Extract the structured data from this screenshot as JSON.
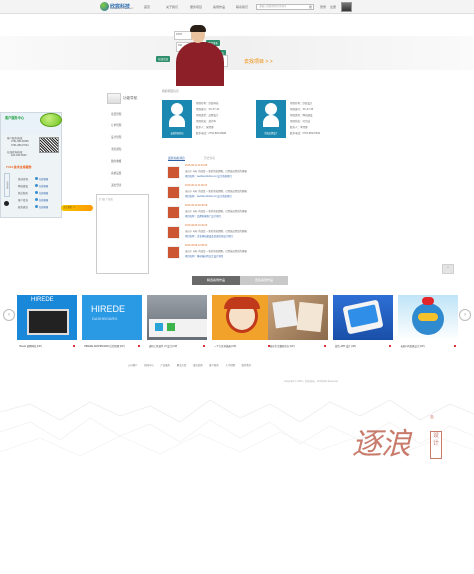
{
  "header": {
    "logo_text": "欣宸科技",
    "logo_sub": "XINCHEN TECHNOLOGY",
    "nav": [
      "首页",
      "关于我们",
      "服务项目",
      "案例作品",
      "联系我们"
    ],
    "search_placeholder": "请输入您要搜索的关键字",
    "search_button": "搜",
    "links": [
      "登录",
      "注册"
    ]
  },
  "hero": {
    "cta": "去找项目 > >",
    "labels": [
      "在线洽谈",
      "项目发布",
      "需求提交"
    ],
    "card_lines": [
      "欢迎您",
      "创意",
      "设计"
    ]
  },
  "left_panel": {
    "title": "客户服务中心",
    "lines": [
      "客户服务热线：",
      "0791-88134698",
      "0791-88107634",
      "在线咨询热线：",
      "400-030-8020"
    ],
    "hotline": "7×24 技术支持服务",
    "rows": [
      {
        "k": "售前咨询",
        "v": "在线客服"
      },
      {
        "k": "网站建设",
        "v": "在线客服"
      },
      {
        "k": "售后服务",
        "v": "在线客服"
      },
      {
        "k": "客户投诉",
        "v": "在线客服"
      },
      {
        "k": "服务建议",
        "v": "在线客服"
      }
    ],
    "vertical_label": "在线客服",
    "button": "关注我们 >>"
  },
  "sidenav": {
    "title": "功能导航",
    "items": [
      "项目管理",
      "订单管理",
      "设计管理",
      "消息通知",
      "我的收藏",
      "系统设置",
      "退出登录"
    ]
  },
  "ad": {
    "title": "[广告] 广告位"
  },
  "info": {
    "title": "我的项目信息",
    "profiles": [
      {
        "label": "安徽欣宸科技",
        "lines": [
          "项目名称：欣宸科技",
          "项目编号：XC-07-34",
          "项目类型：品牌设计",
          "项目状态：进行中",
          "联系人：张经理",
          "联系电话：0791-88134698",
          "联系邮箱：info@xinchen"
        ]
      },
      {
        "label": "欣宸品牌设计",
        "lines": [
          "项目名称：欣宸设计",
          "项目编号：XC-07-35",
          "项目类型：网站建设",
          "项目状态：已完成",
          "联系人：李经理",
          "联系电话：0791-88107634",
          "联系邮箱：web@xinchen"
        ]
      }
    ]
  },
  "tabs": {
    "active": "最新动态消息",
    "inactive": "历史消息"
  },
  "feed": [
    {
      "date": "2015-08-11 14:20:08",
      "l1": "来自于 ugly. 的回复 -- 新的消息提醒，已经发送到您的邮箱",
      "l2": "项目名称：wechat.xinchen.cn 设计系统项目"
    },
    {
      "date": "2015-08-11 14:08:16",
      "l1": "来自于 ugly. 的回复 -- 新的消息提醒，已经发送到您的邮箱",
      "l2": "项目名称：wechat.xinchen.cn 设计系统项目"
    },
    {
      "date": "2015-08-10 09:46:08",
      "l1": "来自于 ugly. 的回复 -- 新的消息提醒，已经发送到您的邮箱",
      "l2": "项目名称：品牌形象推广设计项目"
    },
    {
      "date": "2015-08-09 16:40:20",
      "l1": "来自于 ugly. 的回复 -- 新的消息提醒，已经发送到您的邮箱",
      "l2": "项目名称：企业网站建设及页面优化设计项目"
    },
    {
      "date": "2015-08-08 12:08:02",
      "l1": "来自于 ugly. 的回复 -- 新的消息提醒，已经发送到您的邮箱",
      "l2": "项目名称：移动端应用交互设计项目"
    }
  ],
  "works": {
    "tab_active": "精选案例作品",
    "tab_inactive": "更多案例作品",
    "items": [
      {
        "caption": "Hirede 招聘网站 [UP]"
      },
      {
        "caption": "HIREDE DASHBOARD 后台管理 [UP]"
      },
      {
        "caption": "通讯工具软件 UI 设计 [UP]"
      },
      {
        "caption": "一个小女孩插画 [UP]"
      },
      {
        "caption": "城市生活摄影杂志 [UP]"
      },
      {
        "caption": "蓝色 APP 设计 [UP]"
      },
      {
        "caption": "卡通小鸡形象设计 [UP]"
      }
    ]
  },
  "footer": {
    "nav": [
      "公司简介",
      "新闻中心",
      "产品服务",
      "解决方案",
      "成功案例",
      "客户服务",
      "人才招聘",
      "联系我们"
    ],
    "copyright": "Copyright © 2015，欣宸科技，All Rights Reserved",
    "brand_main": "逐浪",
    "brand_side": "设计",
    "brand_reg": "®"
  }
}
